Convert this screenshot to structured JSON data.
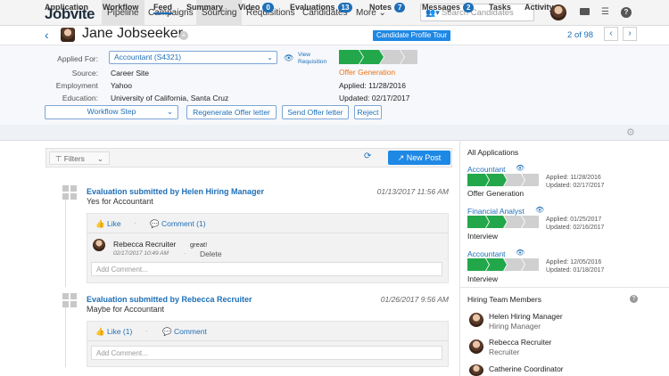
{
  "app": {
    "logo": "Jobvite"
  },
  "nav": [
    "Pipeline",
    "Campaigns",
    "Sourcing",
    "Requisitions",
    "Candidates",
    "More ⌄"
  ],
  "search": {
    "placeholder": "Search Candidates"
  },
  "candidate": {
    "name": "Jane Jobseeker",
    "tour": "Candidate Profile Tour",
    "page_current": "2",
    "page_of": "of",
    "page_total": "98"
  },
  "info": {
    "applied_for_label": "Applied For:",
    "applied_for_value": "Accountant (S4321)",
    "view_requisition": [
      "View",
      "Requisition"
    ],
    "source_label": "Source:",
    "source_value": "Career Site",
    "employment_label": "Employment",
    "employment_value": "Yahoo",
    "education_label": "Education:",
    "education_value": "University of California, Santa Cruz",
    "stage": "Offer Generation",
    "applied_label": "Applied:",
    "applied_value": "11/28/2016",
    "updated_label": "Updated:",
    "updated_value": "02/17/2017",
    "workflow_step": "Workflow Step",
    "buttons": [
      "Regenerate Offer letter",
      "Send Offer letter",
      "Reject"
    ]
  },
  "tabs": [
    {
      "label": "Application"
    },
    {
      "label": "Workflow"
    },
    {
      "label": "Feed"
    },
    {
      "label": "Summary"
    },
    {
      "label": "Video",
      "badge": "0"
    },
    {
      "label": "Evaluations",
      "badge": "13"
    },
    {
      "label": "Notes",
      "badge": "7"
    },
    {
      "label": "Messages",
      "badge": "2"
    },
    {
      "label": "Tasks"
    },
    {
      "label": "Activity"
    }
  ],
  "feed": {
    "filters": "Filters",
    "new_post": "New Post",
    "items": [
      {
        "title": "Evaluation submitted by Helen Hiring Manager",
        "date": "01/13/2017 11:56 AM",
        "body": "Yes for Accountant",
        "like": "Like",
        "comment": "Comment (1)",
        "reply": {
          "name": "Rebecca Recruiter",
          "time": "02/17/2017 10:49 AM",
          "text": "great!",
          "delete": "Delete"
        },
        "add_comment": "Add Comment..."
      },
      {
        "title": "Evaluation submitted by Rebecca Recruiter",
        "date": "01/26/2017 9:56 AM",
        "body": "Maybe for Accountant",
        "like": "Like (1)",
        "comment": "Comment",
        "add_comment": "Add Comment..."
      }
    ]
  },
  "sidebar": {
    "all_apps": "All Applications",
    "apps": [
      {
        "title": "Accountant",
        "applied": "Applied: 11/28/2016",
        "updated": "Updated: 02/17/2017",
        "stage": "Offer Generation"
      },
      {
        "title": "Financial Analyst",
        "applied": "Applied: 01/25/2017",
        "updated": "Updated: 02/16/2017",
        "stage": "Interview"
      },
      {
        "title": "Accountant",
        "applied": "Applied: 12/05/2016",
        "updated": "Updated: 01/18/2017",
        "stage": "Interview"
      }
    ],
    "team_title": "Hiring Team Members",
    "team": [
      {
        "name": "Helen Hiring Manager",
        "role": "Hiring Manager"
      },
      {
        "name": "Rebecca Recruiter",
        "role": "Recruiter"
      },
      {
        "name": "Catherine Coordinator",
        "role": ""
      }
    ]
  },
  "colors": {
    "brand": "#1e6fb7",
    "accent": "#1e88e5",
    "stage_green": "#22a84a",
    "stage_text": "#e8731a"
  }
}
